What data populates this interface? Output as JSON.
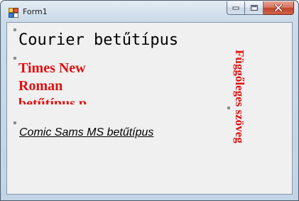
{
  "window": {
    "title": "Form1"
  },
  "labels": {
    "courier": "Courier betűtípus",
    "times": "Times New Roman betűtípus p",
    "comic": "Comic Sams MS betűtípus",
    "vertical": "Függőleges szöveg"
  },
  "colors": {
    "red_text": "#e01010",
    "client_background": "#f0f0f0",
    "close_button": "#c2442c"
  },
  "icons": {
    "app": "winforms-app-icon",
    "minimize": "minimize-icon",
    "maximize": "maximize-icon",
    "close": "close-icon"
  }
}
